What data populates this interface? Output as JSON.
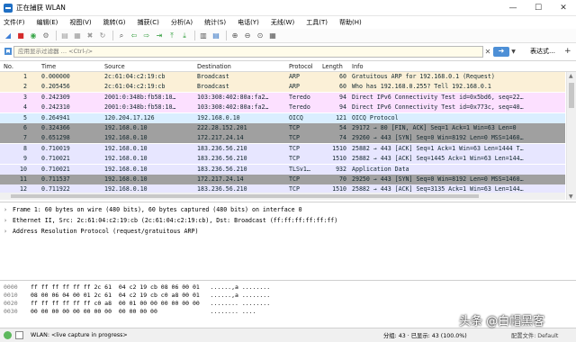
{
  "window": {
    "title": "正在捕获 WLAN",
    "min": "—",
    "max": "☐",
    "close": "✕"
  },
  "menu": [
    "文件(F)",
    "编辑(E)",
    "视图(V)",
    "跳转(G)",
    "捕获(C)",
    "分析(A)",
    "统计(S)",
    "电话(Y)",
    "无线(W)",
    "工具(T)",
    "帮助(H)"
  ],
  "toolbar": {
    "icons": [
      {
        "name": "shark-fin-start-icon",
        "glyph": "◢",
        "color": "#3f7fd6"
      },
      {
        "name": "stop-capture-icon",
        "glyph": "■",
        "color": "#d42a2a"
      },
      {
        "name": "restart-capture-icon",
        "glyph": "◉",
        "color": "#3aa64a"
      },
      {
        "name": "capture-options-icon",
        "glyph": "⚙",
        "color": "#777777"
      },
      {
        "name": "open-file-icon",
        "glyph": "▤",
        "color": "#9a9a9a"
      },
      {
        "name": "save-file-icon",
        "glyph": "▦",
        "color": "#9a9a9a"
      },
      {
        "name": "close-file-icon",
        "glyph": "✖",
        "color": "#9a9a9a"
      },
      {
        "name": "reload-icon",
        "glyph": "↻",
        "color": "#8a8a8a"
      },
      {
        "name": "find-packet-icon",
        "glyph": "⌕",
        "color": "#444444"
      },
      {
        "name": "go-back-icon",
        "glyph": "⇦",
        "color": "#2f9c3a"
      },
      {
        "name": "go-forward-icon",
        "glyph": "⇨",
        "color": "#2f9c3a"
      },
      {
        "name": "go-to-packet-icon",
        "glyph": "⇥",
        "color": "#2f9c3a"
      },
      {
        "name": "go-first-icon",
        "glyph": "⤒",
        "color": "#2f9c3a"
      },
      {
        "name": "go-last-icon",
        "glyph": "⤓",
        "color": "#2f9c3a"
      },
      {
        "name": "autoscroll-icon",
        "glyph": "▥",
        "color": "#555555"
      },
      {
        "name": "colorize-icon",
        "glyph": "▤",
        "color": "#2e6fc2"
      },
      {
        "name": "zoom-in-icon",
        "glyph": "⊕",
        "color": "#555555"
      },
      {
        "name": "zoom-out-icon",
        "glyph": "⊖",
        "color": "#555555"
      },
      {
        "name": "zoom-normal-icon",
        "glyph": "⊙",
        "color": "#555555"
      },
      {
        "name": "resize-columns-icon",
        "glyph": "▦",
        "color": "#555555"
      }
    ]
  },
  "filter": {
    "placeholder": "应用显示过滤器 … <Ctrl-/>",
    "expression_label": "表达式…",
    "add_label": "+"
  },
  "packet_list": {
    "columns": [
      "No.",
      "Time",
      "Source",
      "Destination",
      "Protocol",
      "Length",
      "Info"
    ],
    "rows": [
      {
        "no": "1",
        "time": "0.000000",
        "src": "2c:61:04:c2:19:cb",
        "dst": "Broadcast",
        "proto": "ARP",
        "len": "60",
        "info": "Gratuitous ARP for 192.168.0.1 (Request)",
        "bg": "#fbf0d7",
        "fg": "#12272e"
      },
      {
        "no": "2",
        "time": "0.205456",
        "src": "2c:61:04:c2:19:cb",
        "dst": "Broadcast",
        "proto": "ARP",
        "len": "60",
        "info": "Who has 192.168.0.255? Tell 192.168.0.1",
        "bg": "#fbf0d7",
        "fg": "#12272e"
      },
      {
        "no": "3",
        "time": "0.242309",
        "src": "2001:0:348b:fb58:10…",
        "dst": "103:308:402:80a:fa2…",
        "proto": "Teredo",
        "len": "94",
        "info": "Direct IPv6 Connectivity Test id=0x5bd6, seq=22…",
        "bg": "#fce0ff",
        "fg": "#12272e"
      },
      {
        "no": "4",
        "time": "0.242310",
        "src": "2001:0:348b:fb58:10…",
        "dst": "103:308:402:80a:fa2…",
        "proto": "Teredo",
        "len": "94",
        "info": "Direct IPv6 Connectivity Test id=0x773c, seq=40…",
        "bg": "#fce0ff",
        "fg": "#12272e"
      },
      {
        "no": "5",
        "time": "0.264941",
        "src": "120.204.17.126",
        "dst": "192.168.0.10",
        "proto": "OICQ",
        "len": "121",
        "info": "OICQ Protocol",
        "bg": "#daeeff",
        "fg": "#12272e"
      },
      {
        "no": "6",
        "time": "0.324366",
        "src": "192.168.0.10",
        "dst": "222.28.152.201",
        "proto": "TCP",
        "len": "54",
        "info": "29172 → 80 [FIN, ACK] Seq=1 Ack=1 Win=63 Len=0",
        "bg": "#a0a0a0",
        "fg": "#12272e"
      },
      {
        "no": "7",
        "time": "0.651298",
        "src": "192.168.0.10",
        "dst": "172.217.24.14",
        "proto": "TCP",
        "len": "74",
        "info": "29260 → 443 [SYN] Seq=0 Win=8192 Len=0 MSS=1460…",
        "bg": "#a0a0a0",
        "fg": "#12272e"
      },
      {
        "no": "8",
        "time": "0.710019",
        "src": "192.168.0.10",
        "dst": "183.236.56.210",
        "proto": "TCP",
        "len": "1510",
        "info": "25882 → 443 [ACK] Seq=1 Ack=1 Win=63 Len=1444 T…",
        "bg": "#e7e6ff",
        "fg": "#12272e"
      },
      {
        "no": "9",
        "time": "0.710021",
        "src": "192.168.0.10",
        "dst": "183.236.56.210",
        "proto": "TCP",
        "len": "1510",
        "info": "25882 → 443 [ACK] Seq=1445 Ack=1 Win=63 Len=144…",
        "bg": "#e7e6ff",
        "fg": "#12272e"
      },
      {
        "no": "10",
        "time": "0.710021",
        "src": "192.168.0.10",
        "dst": "183.236.56.210",
        "proto": "TLSv1…",
        "len": "932",
        "info": "Application Data",
        "bg": "#e7e6ff",
        "fg": "#12272e"
      },
      {
        "no": "11",
        "time": "0.711537",
        "src": "192.168.0.10",
        "dst": "172.217.24.14",
        "proto": "TCP",
        "len": "70",
        "info": "29250 → 443 [SYN] Seq=0 Win=8192 Len=0 MSS=1460…",
        "bg": "#a0a0a0",
        "fg": "#12272e"
      },
      {
        "no": "12",
        "time": "0.711922",
        "src": "192.168.0.10",
        "dst": "183.236.56.210",
        "proto": "TCP",
        "len": "1510",
        "info": "25882 → 443 [ACK] Seq=3135 Ack=1 Win=63 Len=144…",
        "bg": "#e7e6ff",
        "fg": "#12272e"
      }
    ]
  },
  "details": {
    "rows": [
      "Frame 1: 60 bytes on wire (480 bits), 60 bytes captured (480 bits) on interface 0",
      "Ethernet II, Src: 2c:61:04:c2:19:cb (2c:61:04:c2:19:cb), Dst: Broadcast (ff:ff:ff:ff:ff:ff)",
      "Address Resolution Protocol (request/gratuitous ARP)"
    ]
  },
  "bytes": {
    "rows": [
      {
        "offset": "0000",
        "hex": "ff ff ff ff ff ff 2c 61  04 c2 19 cb 08 06 00 01",
        "ascii": "......,a ........"
      },
      {
        "offset": "0010",
        "hex": "08 00 06 04 00 01 2c 61  04 c2 19 cb c0 a8 00 01",
        "ascii": "......,a ........"
      },
      {
        "offset": "0020",
        "hex": "ff ff ff ff ff ff c0 a8  00 01 00 00 00 00 00 00",
        "ascii": "........ ........"
      },
      {
        "offset": "0030",
        "hex": "00 00 00 00 00 00 00 00  00 00 00 00",
        "ascii": "........ ...."
      }
    ]
  },
  "status": {
    "interface": "WLAN: <live capture in progress>",
    "counts": "分组: 43 · 已显示: 43 (100.0%)",
    "profile": "配置文件: Default"
  },
  "watermark": "头条 @白帽黑客"
}
